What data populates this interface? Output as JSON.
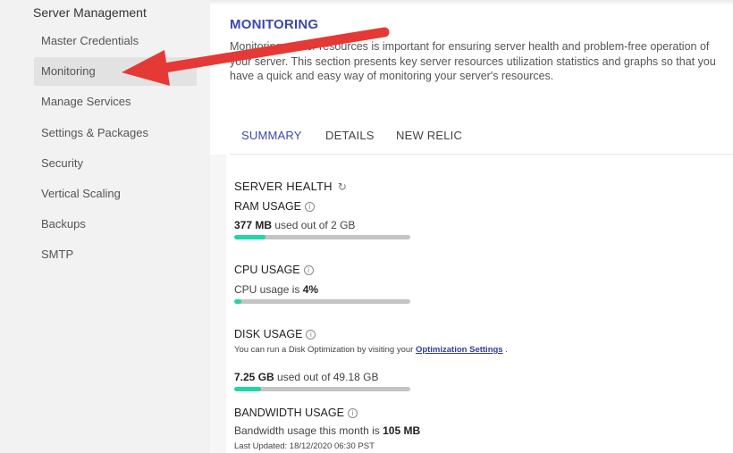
{
  "sidebar": {
    "title": "Server Management",
    "items": [
      {
        "label": "Master Credentials"
      },
      {
        "label": "Monitoring",
        "active": true
      },
      {
        "label": "Manage Services"
      },
      {
        "label": "Settings & Packages"
      },
      {
        "label": "Security"
      },
      {
        "label": "Vertical Scaling"
      },
      {
        "label": "Backups"
      },
      {
        "label": "SMTP"
      }
    ]
  },
  "main": {
    "title": "MONITORING",
    "intro": "Monitoring server resources is important for ensuring server health and problem-free operation of your server. This section presents key server resources utilization statistics and graphs so that you have a quick and easy way of monitoring your server's resources.",
    "tabs": [
      {
        "label": "SUMMARY",
        "active": true
      },
      {
        "label": "DETAILS"
      },
      {
        "label": "NEW RELIC"
      }
    ]
  },
  "health": {
    "title": "SERVER HEALTH",
    "refresh_icon": "refresh-icon",
    "ram": {
      "title": "RAM USAGE",
      "value": "377 MB",
      "suffix": " used out of 2 GB",
      "fraction": 0.18
    },
    "cpu": {
      "title": "CPU USAGE",
      "prefix": "CPU usage is ",
      "value": "4%",
      "fraction": 0.04
    },
    "disk": {
      "title": "DISK USAGE",
      "note_prefix": "You can run a Disk Optimization by visiting your ",
      "note_link": "Optimization Settings",
      "note_suffix": " .",
      "value": "7.25 GB",
      "suffix": " used out of 49.18 GB",
      "fraction": 0.15
    },
    "bandwidth": {
      "title": "BANDWIDTH USAGE",
      "prefix": "Bandwidth usage this month is ",
      "value": "105 MB",
      "last_updated": "Last Updated: 18/12/2020 06:30 PST"
    }
  },
  "colors": {
    "accent": "#3b4aa8",
    "bar_fill": "#1ed7a3",
    "bar_track": "#c4c4c4",
    "annotation_arrow": "#e53935"
  }
}
